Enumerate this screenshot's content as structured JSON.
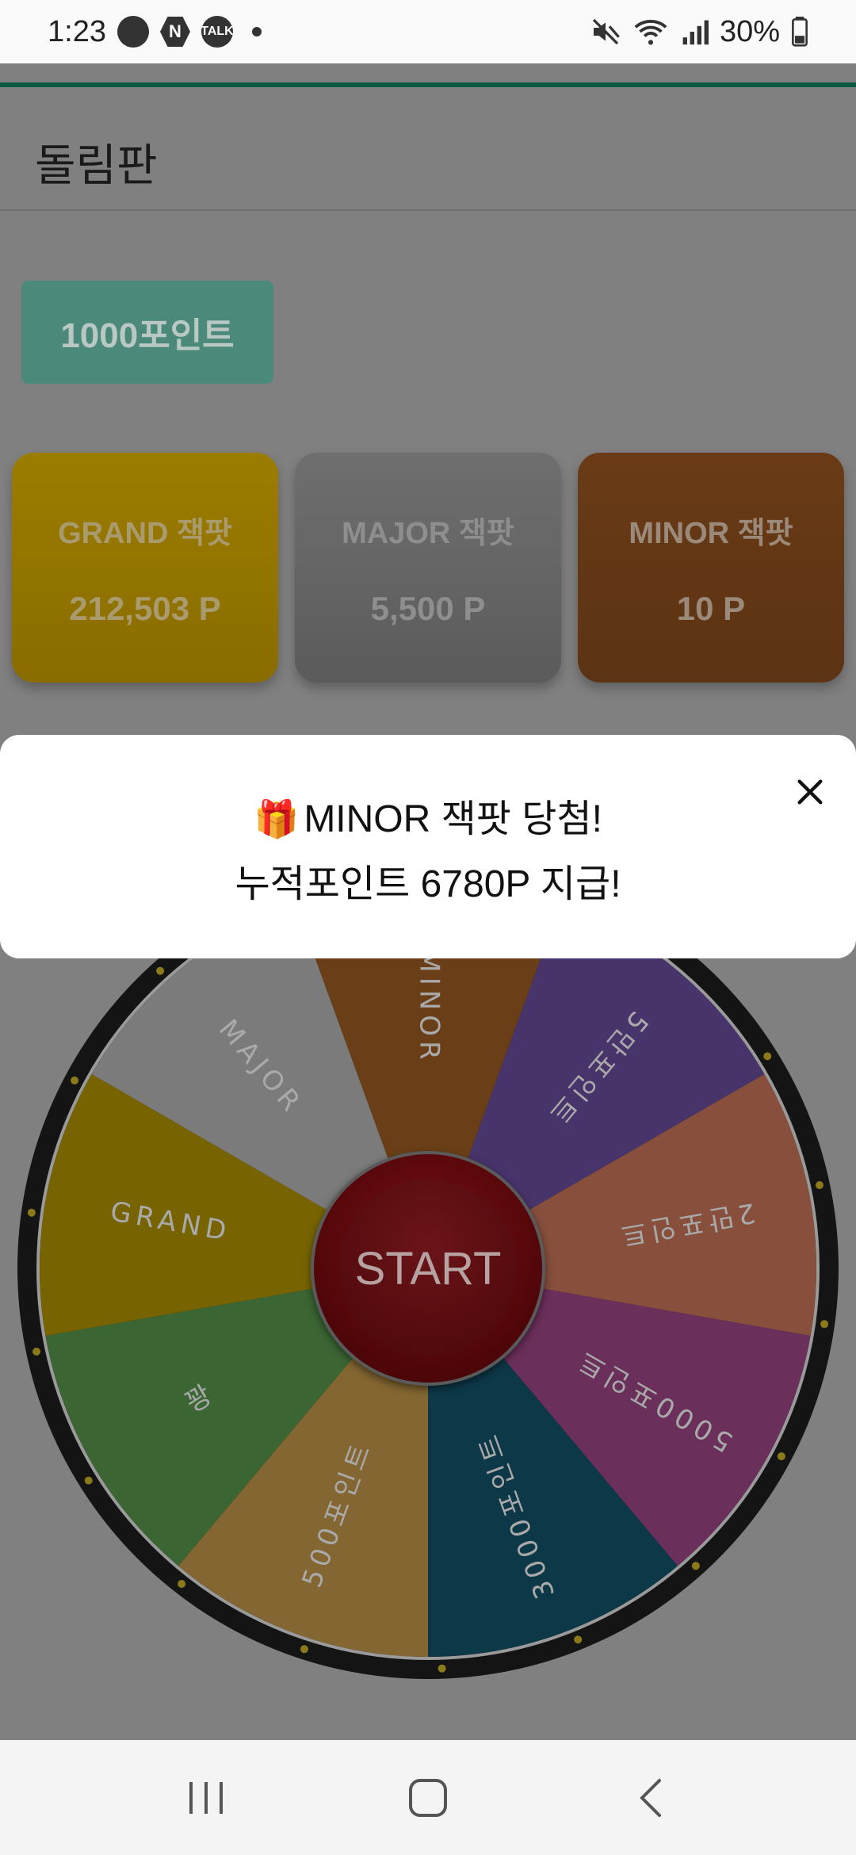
{
  "status_bar": {
    "time": "1:23",
    "notif_n": "N",
    "notif_talk": "TALK",
    "battery": "30%"
  },
  "app": {
    "title": "돌림판",
    "points_button": "1000포인트"
  },
  "jackpots": [
    {
      "title": "GRAND 잭팟",
      "value": "212,503 P"
    },
    {
      "title": "MAJOR 잭팟",
      "value": "5,500 P"
    },
    {
      "title": "MINOR 잭팟",
      "value": "10 P"
    }
  ],
  "wheel": {
    "start_label": "START",
    "segments": [
      {
        "label": "MINOR",
        "color": "#6a3f17"
      },
      {
        "label": "5만포인트",
        "color": "#47346a"
      },
      {
        "label": "2만포인트",
        "color": "#874f3c"
      },
      {
        "label": "5000포인트",
        "color": "#6b2f5b"
      },
      {
        "label": "3000포인트",
        "color": "#0d3848"
      },
      {
        "label": "500포인트",
        "color": "#836631"
      },
      {
        "label": "꽝",
        "color": "#3b6633"
      },
      {
        "label": "GRAND",
        "color": "#776400"
      },
      {
        "label": "MAJOR",
        "color": "#7b7b7b"
      }
    ]
  },
  "popup": {
    "line1": "MINOR 잭팟 당첨!",
    "line2": "누적포인트 6780P 지급!"
  }
}
